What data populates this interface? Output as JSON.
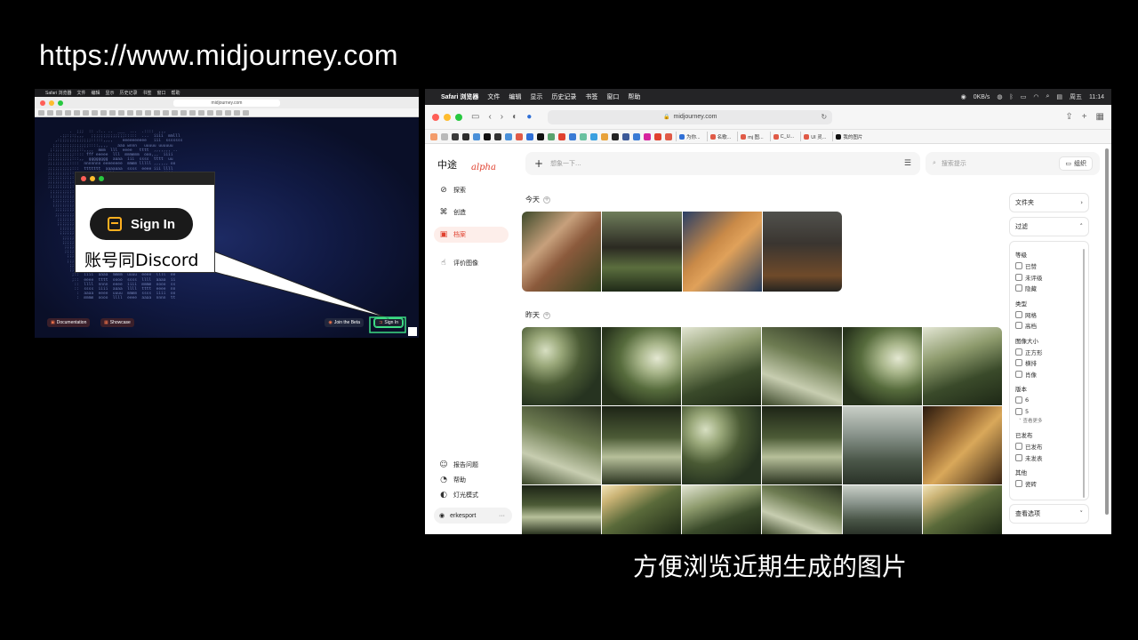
{
  "title_url": "https://www.midjourney.com",
  "caption": "方便浏览近期生成的图片",
  "left_shot": {
    "menubar": [
      "Safari 浏览器",
      "文件",
      "编辑",
      "显示",
      "历史记录",
      "书签",
      "窗口",
      "帮助"
    ],
    "url": "midjourney.com",
    "footer": {
      "documentation": "Documentation",
      "showcase": "Showcase",
      "join_beta": "Join the Beta",
      "sign_in": "Sign In"
    }
  },
  "callout": {
    "sign_in_label": "Sign In",
    "text": "账号同Discord"
  },
  "browser": {
    "menubar": {
      "app": "Safari 浏览器",
      "items": [
        "文件",
        "编辑",
        "显示",
        "历史记录",
        "书签",
        "窗口",
        "帮助"
      ],
      "clock_day": "周五",
      "clock_time": "11:14",
      "net": "0KB/s"
    },
    "address": "midjourney.com",
    "tabs": [
      "为你...",
      "名歌...",
      "mj 图...",
      "C_U...",
      "UI 灵...",
      "我的图片"
    ],
    "mj": {
      "brand": "中途",
      "brand_tag": "alpha",
      "nav": [
        {
          "icon": "compass-icon",
          "glyph": "⊘",
          "label": "探索"
        },
        {
          "icon": "brush-icon",
          "glyph": "⌘",
          "label": "创造"
        },
        {
          "icon": "image-icon",
          "glyph": "▣",
          "label": "档案"
        },
        {
          "icon": "thumbs-up-icon",
          "glyph": "👍",
          "label": "评价图像"
        }
      ],
      "bottom_nav": [
        {
          "icon": "report-icon",
          "glyph": "☺",
          "label": "报告问题"
        },
        {
          "icon": "help-icon",
          "glyph": "◔",
          "label": "帮助"
        },
        {
          "icon": "light-mode-icon",
          "glyph": "◐",
          "label": "灯光模式"
        }
      ],
      "username": "erkesport",
      "prompt_placeholder": "想象一下...",
      "search_placeholder": "搜索提示",
      "organize_label": "组织",
      "section_today": "今天",
      "section_yesterday": "昨天",
      "filter": {
        "folders": "文件夹",
        "filter": "过滤",
        "view_options": "查看选项",
        "groups": [
          {
            "head": "等级",
            "options": [
              "已赞",
              "未评级",
              "隐藏"
            ]
          },
          {
            "head": "类型",
            "options": [
              "网格",
              "高档"
            ]
          },
          {
            "head": "图像大小",
            "options": [
              "正方形",
              "横排",
              "肖像"
            ]
          },
          {
            "head": "版本",
            "options": [
              "6",
              "5"
            ],
            "more": "查看更多"
          },
          {
            "head": "已发布",
            "options": [
              "已发布",
              "未发表"
            ]
          },
          {
            "head": "其他",
            "options": [
              "瓷砖"
            ]
          }
        ]
      }
    }
  },
  "colors": {
    "accent": "#e0412f",
    "active_bg": "#fdeeea",
    "signin_border": "#3ddc84"
  }
}
